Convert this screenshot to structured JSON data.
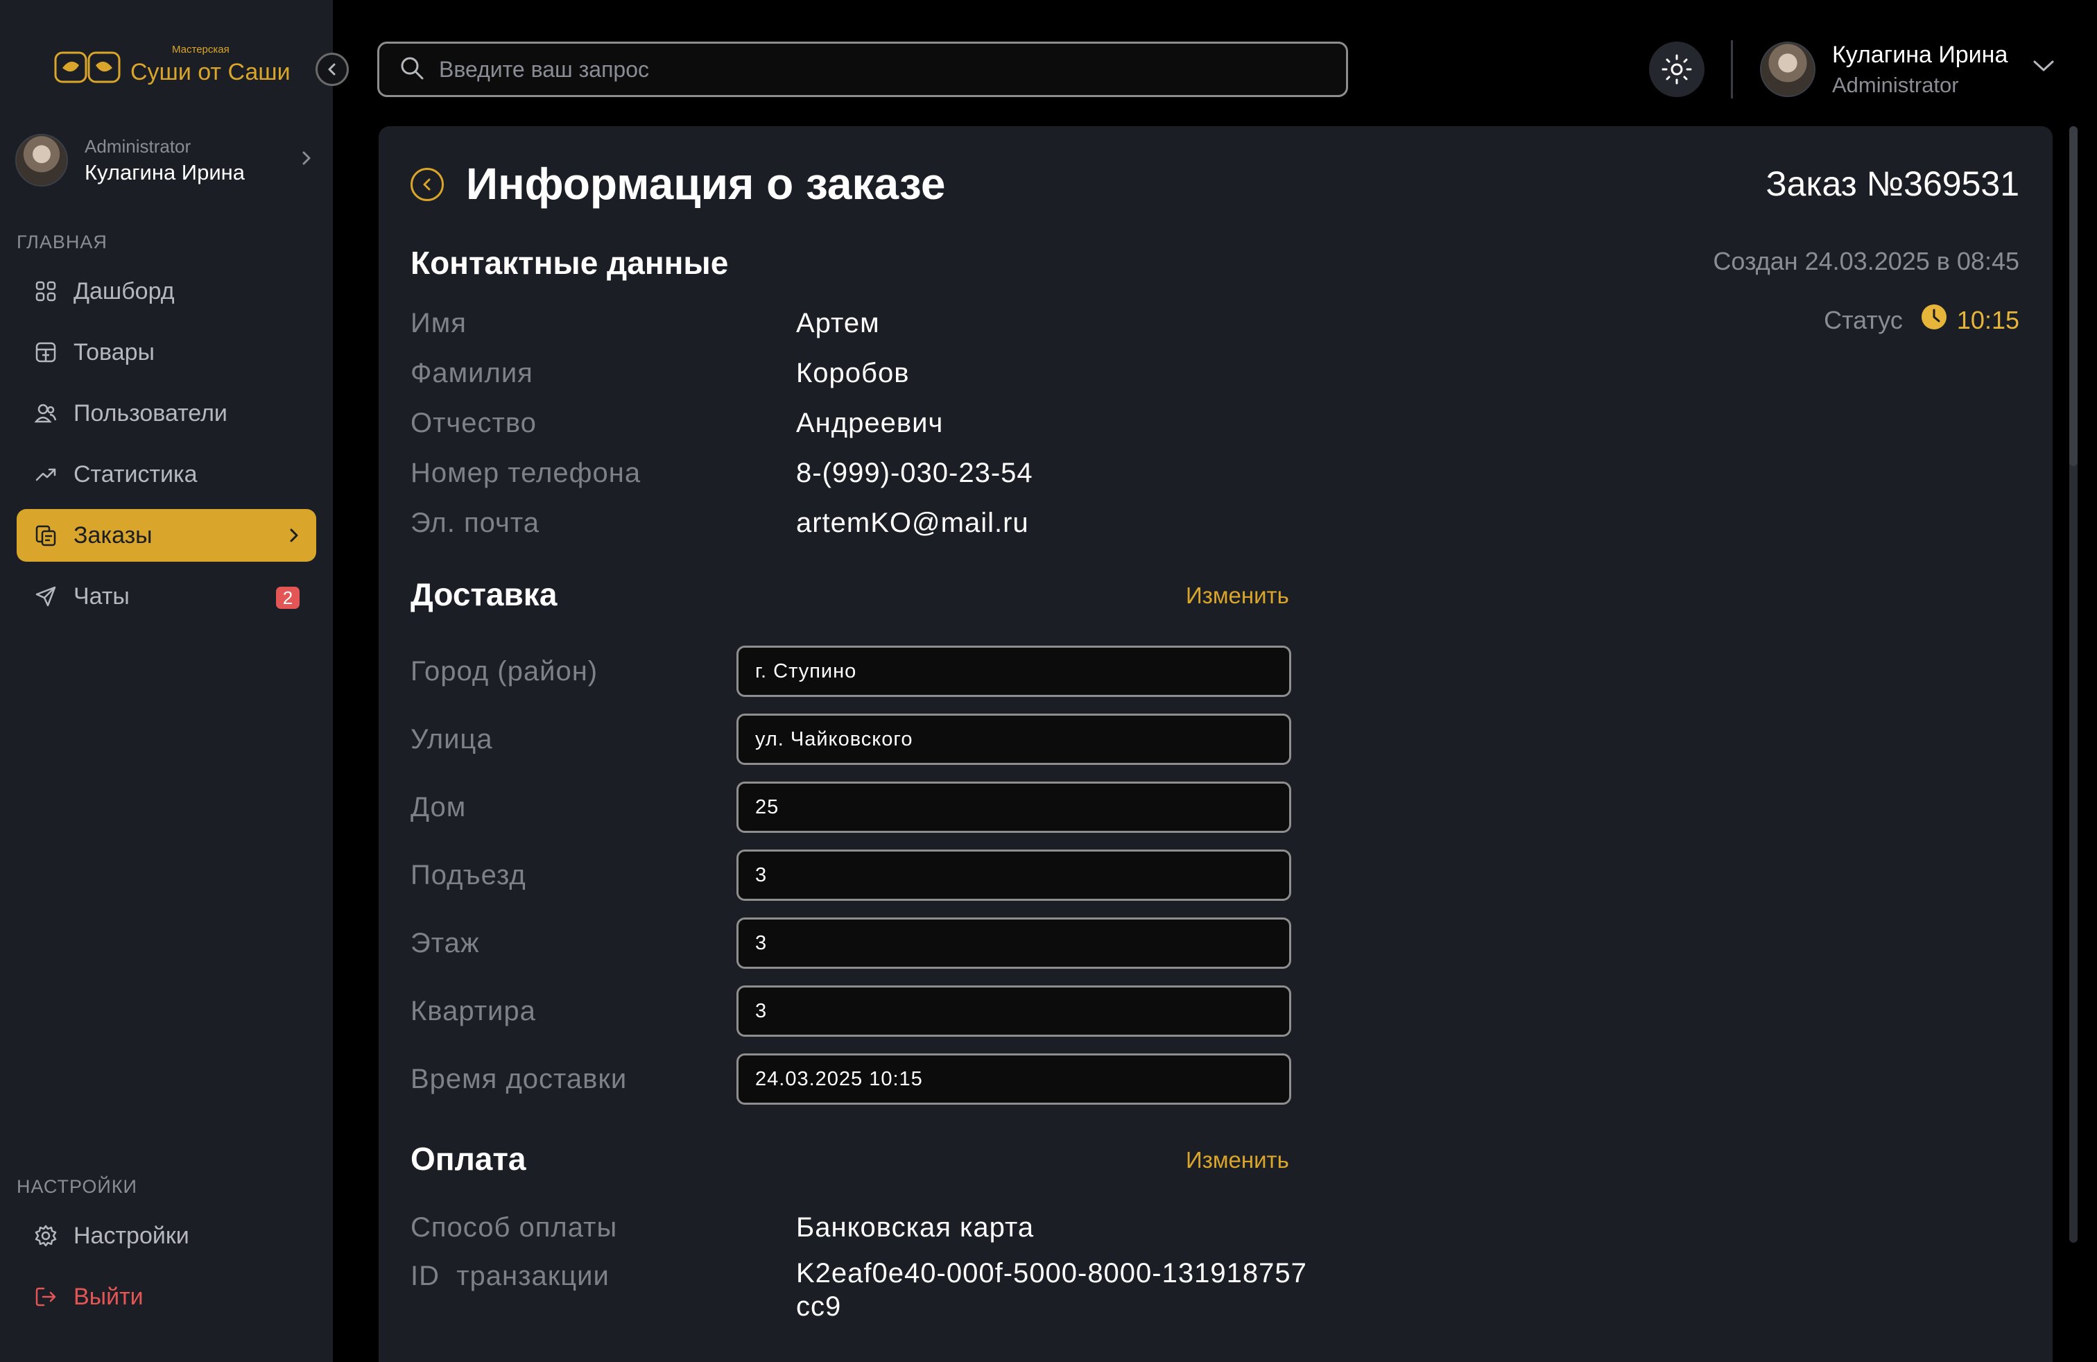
{
  "brand": {
    "small": "Мастерская",
    "name": "Суши от Саши",
    "accent": "#d9a52a"
  },
  "sidebar": {
    "profile": {
      "role": "Administrator",
      "name": "Кулагина Ирина"
    },
    "main_label": "ГЛАВНАЯ",
    "items": [
      {
        "label": "Дашборд",
        "icon": "dashboard-icon"
      },
      {
        "label": "Товары",
        "icon": "products-icon"
      },
      {
        "label": "Пользователи",
        "icon": "users-icon"
      },
      {
        "label": "Статистика",
        "icon": "trend-icon"
      },
      {
        "label": "Заказы",
        "icon": "orders-icon",
        "active": true
      },
      {
        "label": "Чаты",
        "icon": "send-icon",
        "badge": "2"
      }
    ],
    "settings_label": "НАСТРОЙКИ",
    "settings": {
      "label": "Настройки",
      "icon": "gear-icon"
    },
    "logout": {
      "label": "Выйти",
      "icon": "logout-icon"
    }
  },
  "header": {
    "search_placeholder": "Введите ваш запрос",
    "user": {
      "name": "Кулагина Ирина",
      "role": "Administrator"
    }
  },
  "order": {
    "title": "Информация о заказе",
    "number": "Заказ №369531",
    "created": "Создан 24.03.2025 в 08:45",
    "status_label": "Статус",
    "status_time": "10:15",
    "status_color": "#e7b53a"
  },
  "contacts": {
    "title": "Контактные данные",
    "rows": [
      {
        "label": "Имя",
        "value": "Артем"
      },
      {
        "label": "Фамилия",
        "value": "Коробов"
      },
      {
        "label": "Отчество",
        "value": "Андреевич"
      },
      {
        "label": "Номер телефона",
        "value": "8-(999)-030-23-54"
      },
      {
        "label": "Эл. почта",
        "value": "artemKO@mail.ru"
      }
    ]
  },
  "delivery": {
    "title": "Доставка",
    "edit_label": "Изменить",
    "fields": [
      {
        "label": "Город (район)",
        "value": "г. Ступино"
      },
      {
        "label": "Улица",
        "value": "ул. Чайковского"
      },
      {
        "label": "Дом",
        "value": "25"
      },
      {
        "label": "Подъезд",
        "value": "3"
      },
      {
        "label": "Этаж",
        "value": "3"
      },
      {
        "label": "Квартира",
        "value": "3"
      },
      {
        "label": "Время доставки",
        "value": "24.03.2025 10:15"
      }
    ]
  },
  "payment": {
    "title": "Оплата",
    "edit_label": "Изменить",
    "method_label": "Способ оплаты",
    "method_value": "Банковская карта",
    "tx_label": "ID  транзакции",
    "tx_value": "K2eaf0e40-000f-5000-8000-131918757cc9"
  }
}
